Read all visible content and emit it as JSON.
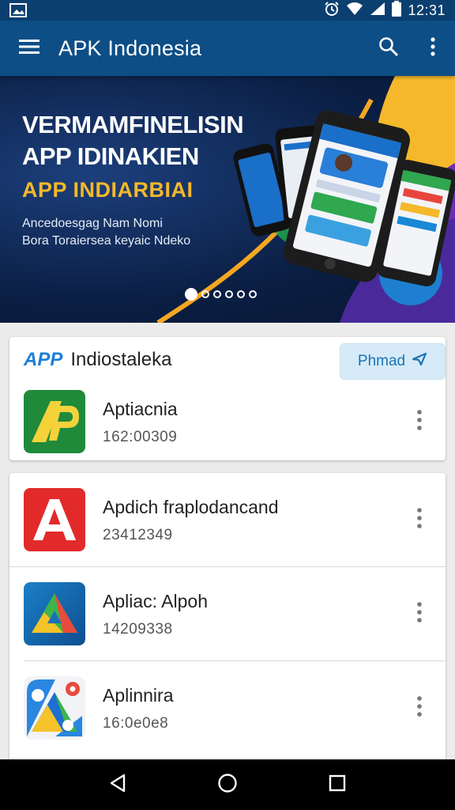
{
  "status_bar": {
    "time": "12:31",
    "icons": [
      "gallery-icon",
      "alarm-icon",
      "wifi-icon",
      "signal-icon",
      "battery-icon"
    ]
  },
  "app_bar": {
    "title": "APK Indonesia",
    "icons": [
      "menu-icon",
      "search-icon",
      "more-vert-icon"
    ]
  },
  "banner": {
    "line1": "VERMAMFINELISIN",
    "line2": "APP IDINAKIEN",
    "line3": "APP INDIARBIAI",
    "sub1": "Ancedoesgag Nam Nomi",
    "sub2": "Bora Toraiersea keyaic Ndeko",
    "slide_count": 6,
    "active_slide": 1
  },
  "featured": {
    "brand": "APP",
    "title": "Indiostaleka",
    "button_label": "Phmad",
    "items": [
      {
        "name": "Aptiacnia",
        "meta": "162:00309",
        "icon": "ap-logo-icon"
      }
    ]
  },
  "list": {
    "items": [
      {
        "name": "Apdich fraplodancand",
        "meta": "23412349",
        "icon": "red-a-icon"
      },
      {
        "name": "Apliac: Alpoh",
        "meta": "14209338",
        "icon": "green-a-icon"
      },
      {
        "name": "Aplinnira",
        "meta": "16:0e0e8",
        "icon": "maps-a-icon"
      }
    ]
  },
  "colors": {
    "app_bar": "#0d4e86",
    "status_bar": "#0b3f70",
    "accent_yellow": "#f5b82a",
    "brand_blue": "#1d7fd8"
  },
  "nav_bar": {
    "icons": [
      "back-icon",
      "home-icon",
      "recents-icon"
    ]
  }
}
